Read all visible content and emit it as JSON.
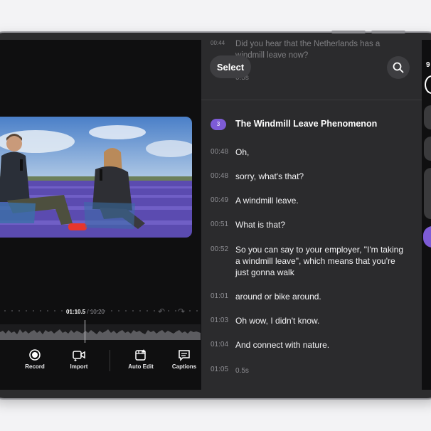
{
  "device": {
    "frame_color": "#2c2c2e",
    "screen_color": "#101012"
  },
  "editor": {
    "timecode_current": "01:10.5",
    "timecode_sep": "/",
    "timecode_total": "10:20",
    "toolbar": [
      {
        "label": "Record",
        "icon": "record-icon"
      },
      {
        "label": "Import",
        "icon": "import-camera-icon"
      },
      {
        "label": "Auto Edit",
        "icon": "auto-edit-icon"
      },
      {
        "label": "Captions",
        "icon": "captions-icon"
      }
    ]
  },
  "transcript": {
    "faded_top": {
      "time": "00:44",
      "text": "Did you hear that the Netherlands has a windmill leave now?"
    },
    "faded_sub": "0.5s",
    "select_label": "Select",
    "search_icon": "search-icon",
    "chapter": {
      "number": "3",
      "title": "The Windmill Leave Phenomenon",
      "badge_color": "#7d5bd6"
    },
    "lines": [
      {
        "time": "00:48",
        "text": "Oh,"
      },
      {
        "time": "00:48",
        "text": "sorry, what's that?"
      },
      {
        "time": "00:49",
        "text": "A windmill leave."
      },
      {
        "time": "00:51",
        "text": "What is that?"
      },
      {
        "time": "00:52",
        "text": "So you can say to your employer, \"I'm taking a windmill leave\", which means that you're just gonna walk"
      },
      {
        "time": "01:01",
        "text": "around or bike around."
      },
      {
        "time": "01:03",
        "text": "Oh wow, I didn't know."
      },
      {
        "time": "01:04",
        "text": "And connect with nature."
      },
      {
        "time": "01:05",
        "text": "0.5s"
      }
    ]
  },
  "side_panel": {
    "number": "9",
    "accent": "#7d5bd6"
  }
}
